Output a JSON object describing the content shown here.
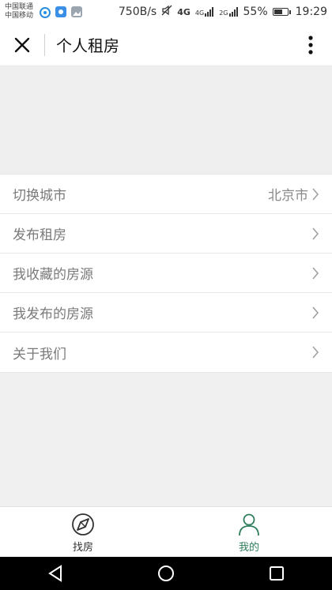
{
  "status_bar": {
    "carrier_1": "中国联通",
    "carrier_2": "中国移动",
    "net_speed": "750B/s",
    "net_1": "4G",
    "net_2": "4G",
    "net_3": "2G",
    "battery": "55%",
    "time": "19:29"
  },
  "header": {
    "title": "个人租房"
  },
  "menu": {
    "items": [
      {
        "label": "切换城市",
        "value": "北京市"
      },
      {
        "label": "发布租房"
      },
      {
        "label": "我收藏的房源"
      },
      {
        "label": "我发布的房源"
      },
      {
        "label": "关于我们"
      }
    ]
  },
  "tabbar": {
    "tabs": [
      {
        "label": "找房"
      },
      {
        "label": "我的"
      }
    ],
    "active_color": "#2e7d5b"
  }
}
